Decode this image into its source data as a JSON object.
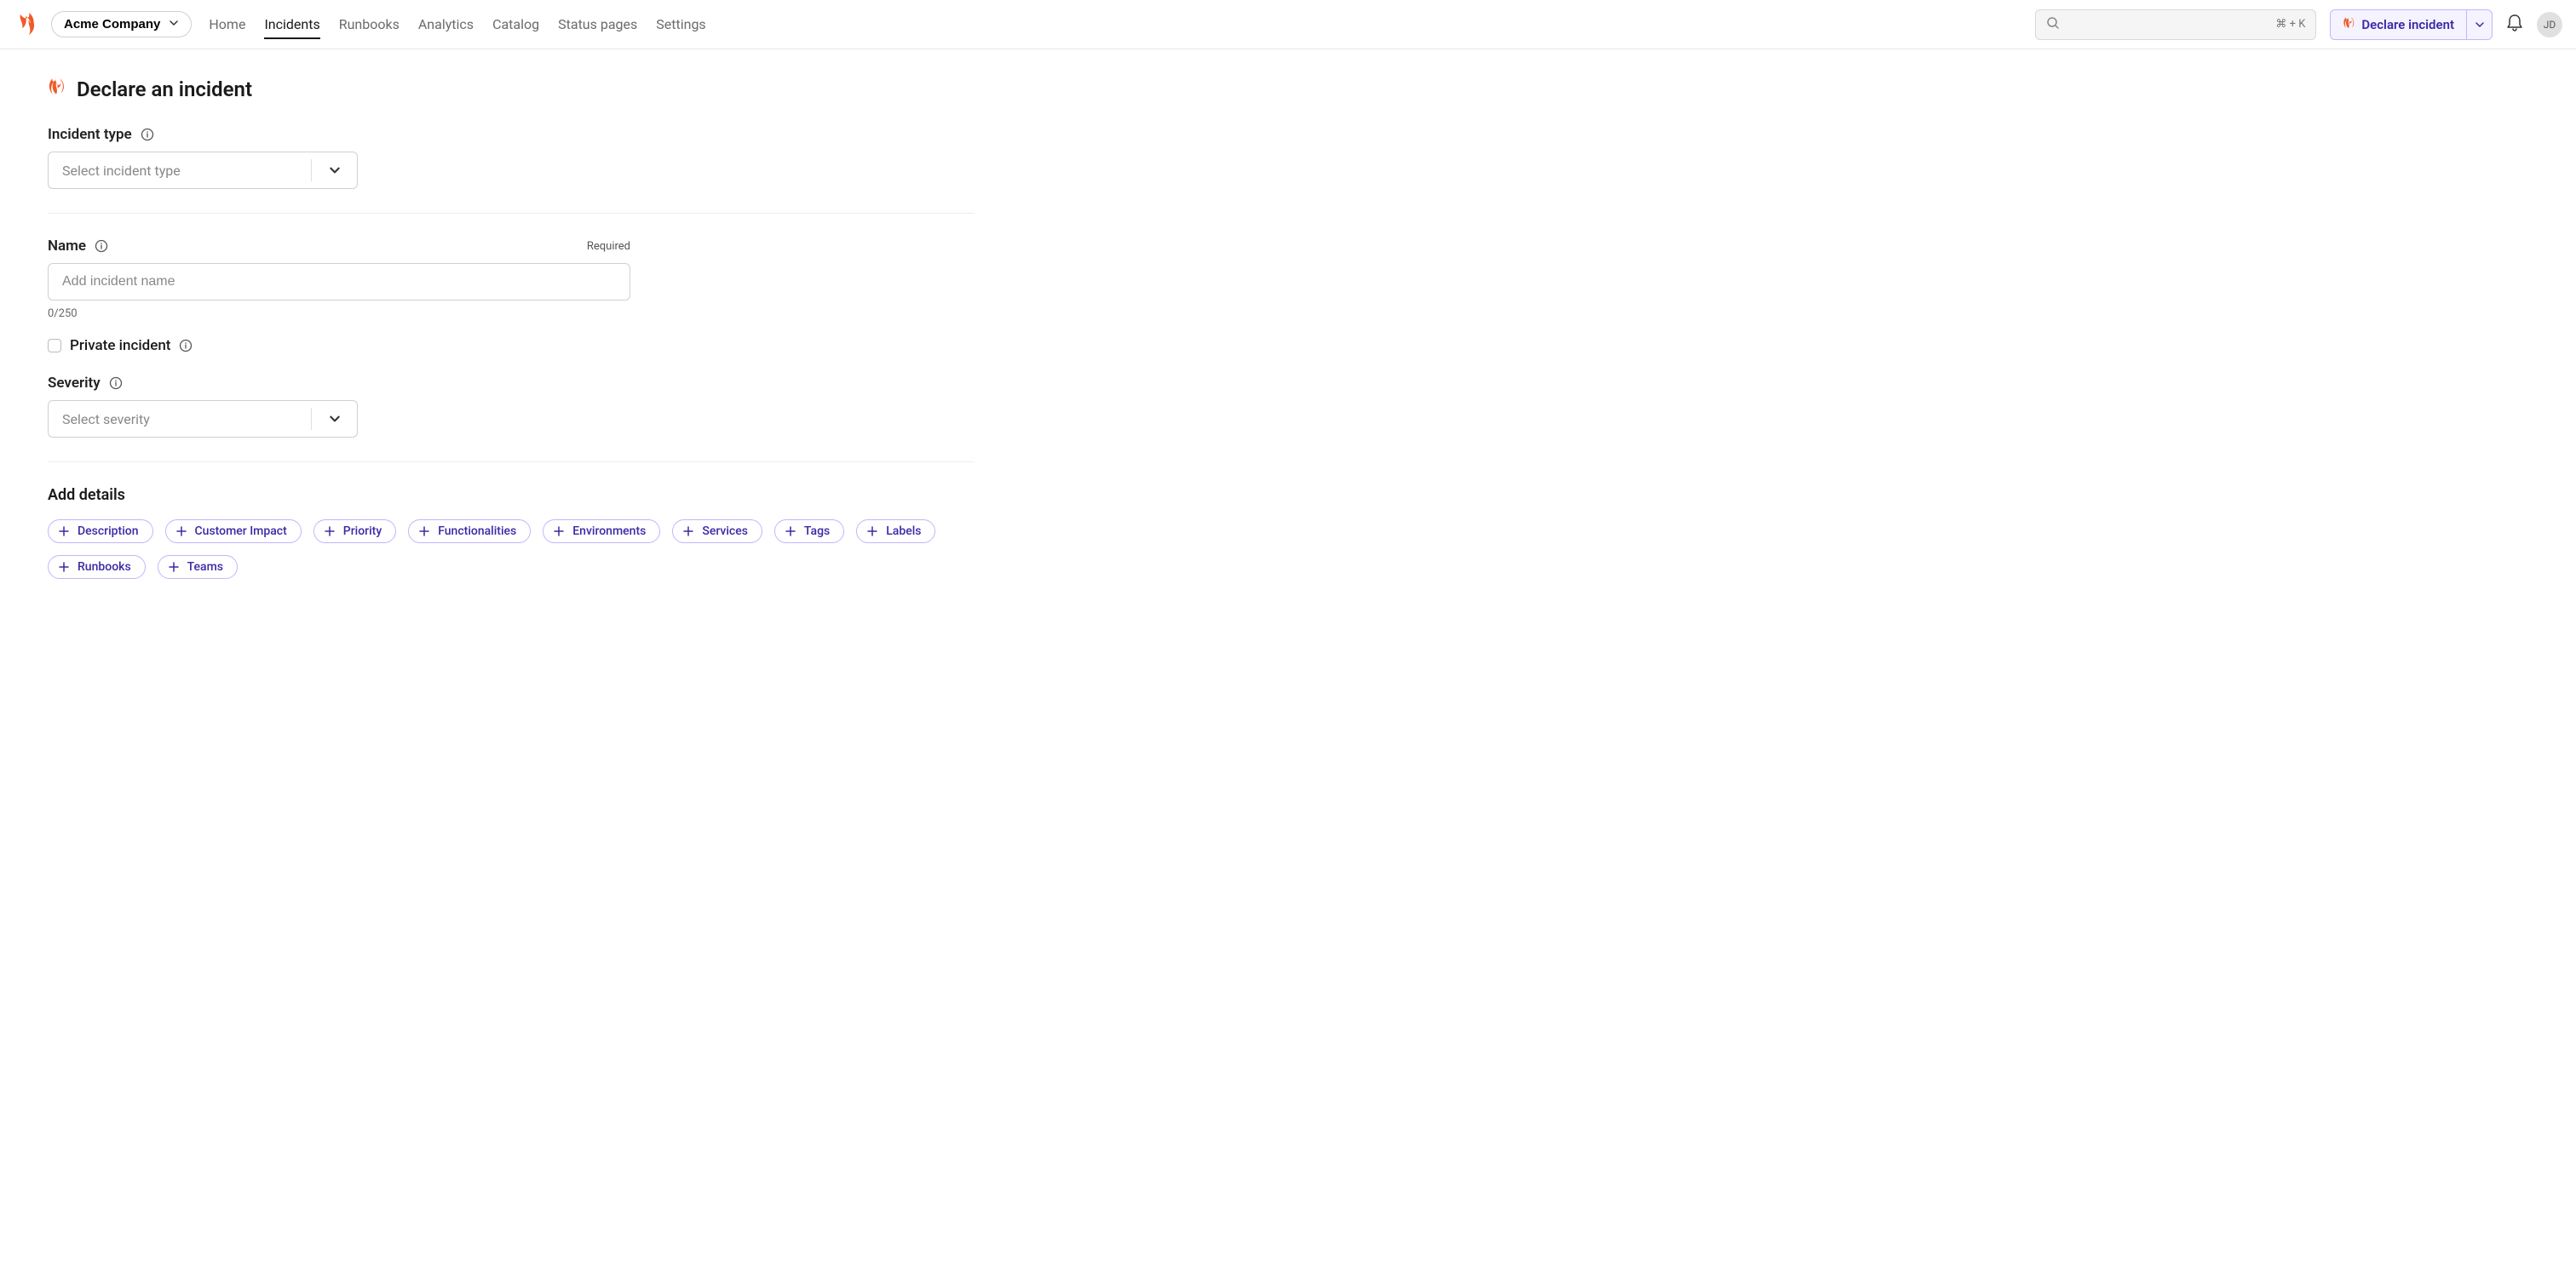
{
  "org": {
    "name": "Acme Company"
  },
  "nav": {
    "items": [
      {
        "label": "Home"
      },
      {
        "label": "Incidents"
      },
      {
        "label": "Runbooks"
      },
      {
        "label": "Analytics"
      },
      {
        "label": "Catalog"
      },
      {
        "label": "Status pages"
      },
      {
        "label": "Settings"
      }
    ],
    "activeIndex": 1
  },
  "search": {
    "shortcut": "⌘  + K"
  },
  "declare_button": {
    "label": "Declare incident"
  },
  "avatar": {
    "initials": "JD"
  },
  "page": {
    "title": "Declare an incident"
  },
  "fields": {
    "incident_type": {
      "label": "Incident type",
      "placeholder": "Select incident type"
    },
    "name": {
      "label": "Name",
      "required_text": "Required",
      "placeholder": "Add incident name",
      "char_count": "0/250"
    },
    "private": {
      "label": "Private incident"
    },
    "severity": {
      "label": "Severity",
      "placeholder": "Select severity"
    }
  },
  "details": {
    "title": "Add details",
    "chips": [
      "Description",
      "Customer Impact",
      "Priority",
      "Functionalities",
      "Environments",
      "Services",
      "Tags",
      "Labels",
      "Runbooks",
      "Teams"
    ]
  }
}
